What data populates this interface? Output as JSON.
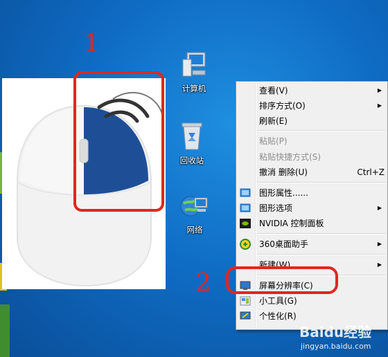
{
  "annotations": {
    "step1": "1",
    "step2": "2"
  },
  "desktop_icons": [
    {
      "label": "计算机",
      "icon": "computer-icon"
    },
    {
      "label": "回收站",
      "icon": "recycle-bin-icon"
    },
    {
      "label": "网络",
      "icon": "network-icon"
    }
  ],
  "context_menu": {
    "view": "查看(V)",
    "sort_by": "排序方式(O)",
    "refresh": "刷新(E)",
    "paste": "粘贴(P)",
    "paste_shortcut": "粘贴快捷方式(S)",
    "undo_delete": "撤消 删除(U)",
    "undo_shortcut": "Ctrl+Z",
    "graphics_properties": "图形属性......",
    "graphics_options": "图形选项",
    "nvidia_panel": "NVIDIA 控制面板",
    "desktop_360": "360桌面助手",
    "new": "新建(W)",
    "screen_resolution": "屏幕分辨率(C)",
    "gadgets": "小工具(G)",
    "personalize": "个性化(R)"
  },
  "watermark": {
    "logo": "Baidu经验",
    "url": "jingyan.baidu.com"
  },
  "colors": {
    "annotation_red": "#e0271e",
    "mouse_blue": "#1e4f96",
    "desktop_blue": "#0f6cc4"
  }
}
